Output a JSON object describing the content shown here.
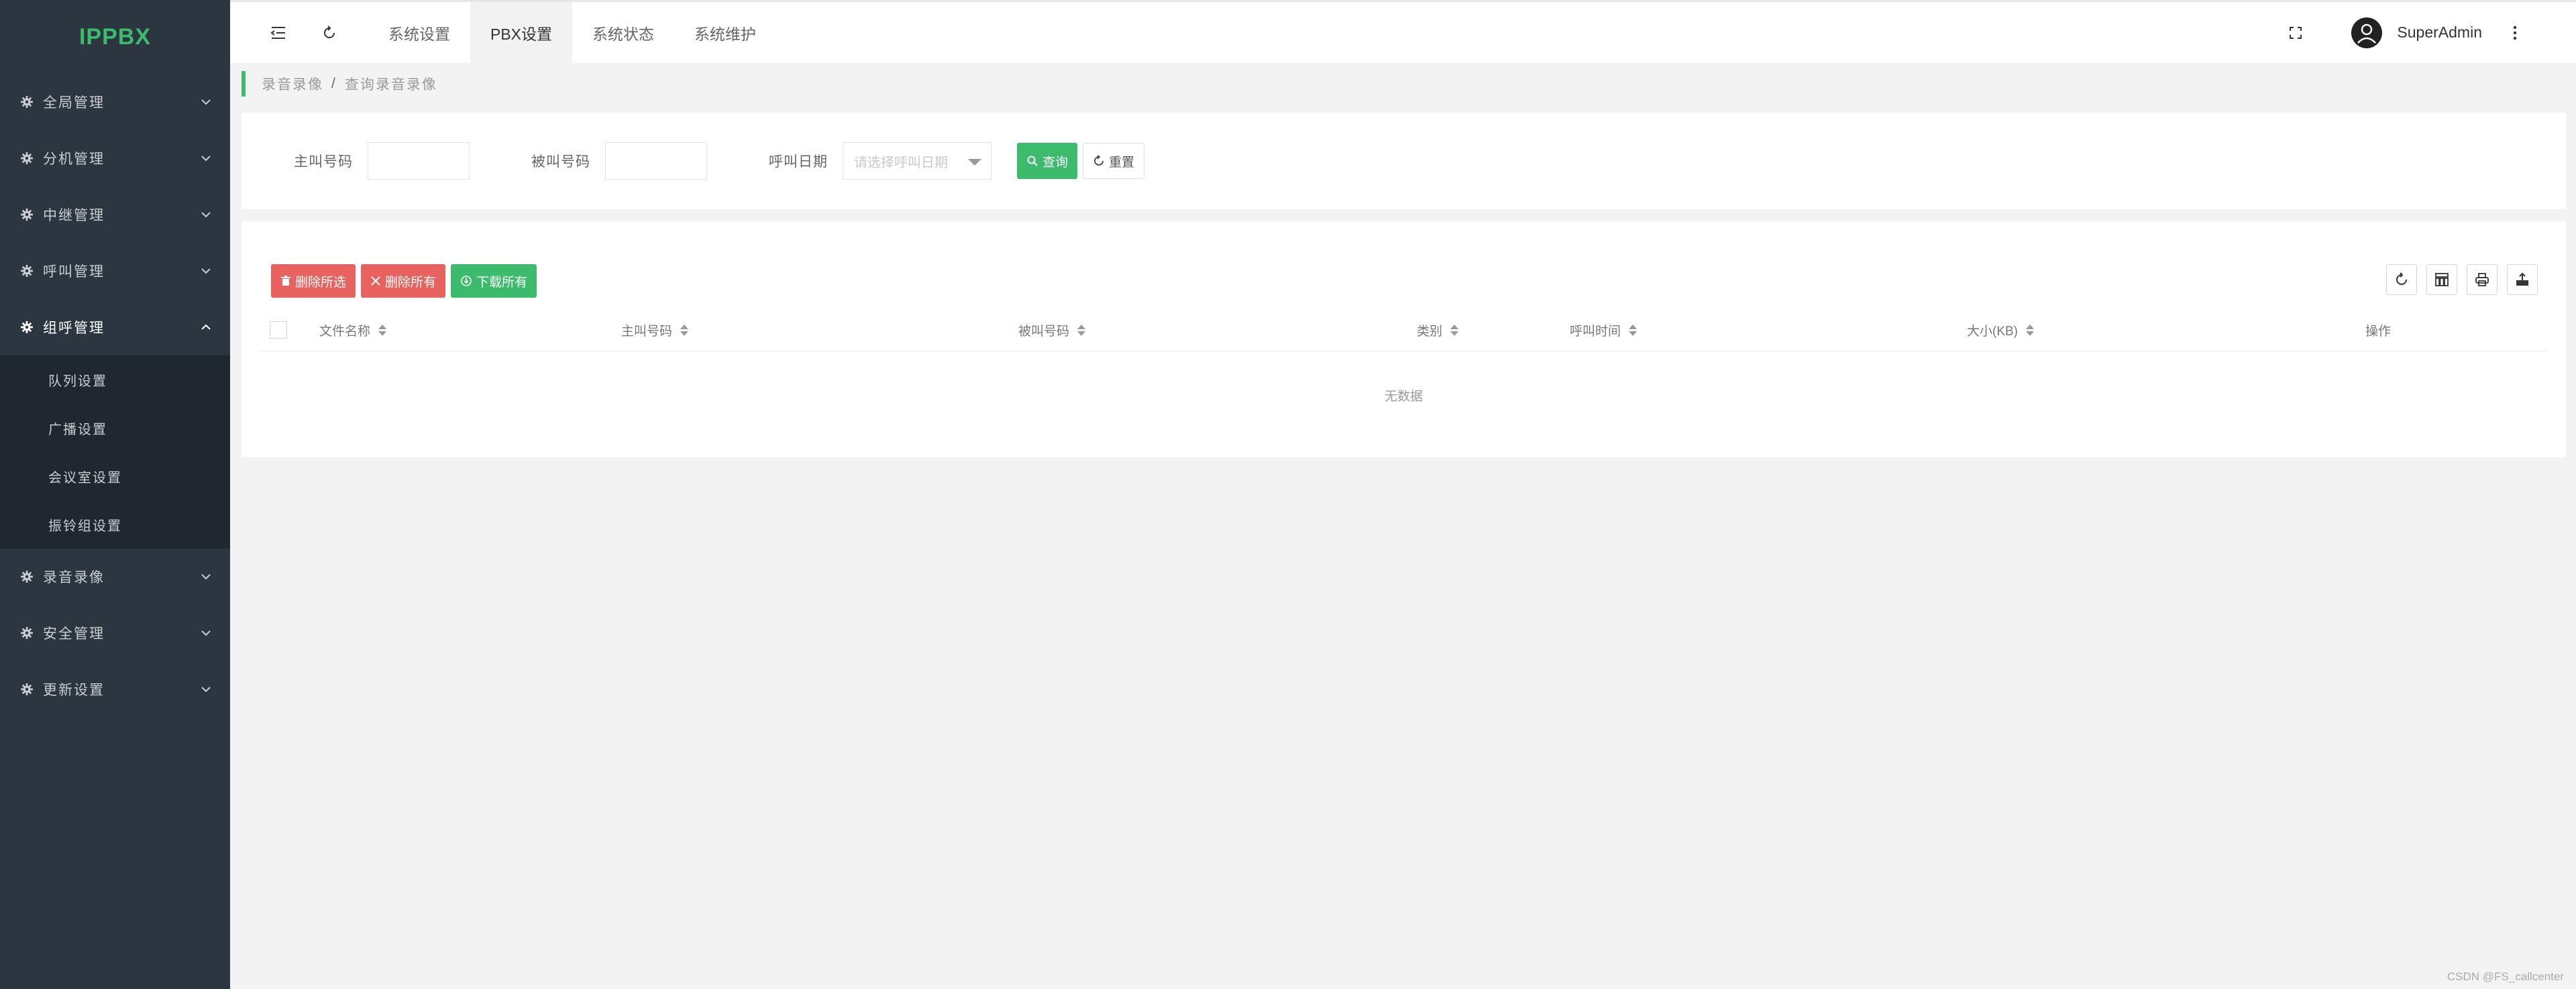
{
  "app": {
    "logo": "IPPBX"
  },
  "sidebar": {
    "items": [
      {
        "label": "全局管理"
      },
      {
        "label": "分机管理"
      },
      {
        "label": "中继管理"
      },
      {
        "label": "呼叫管理"
      },
      {
        "label": "组呼管理",
        "expanded": true,
        "children": [
          "队列设置",
          "广播设置",
          "会议室设置",
          "振铃组设置"
        ]
      },
      {
        "label": "录音录像"
      },
      {
        "label": "安全管理"
      },
      {
        "label": "更新设置"
      }
    ]
  },
  "topbar": {
    "tabs": [
      "系统设置",
      "PBX设置",
      "系统状态",
      "系统维护"
    ],
    "active_tab": "PBX设置",
    "user": "SuperAdmin"
  },
  "breadcrumb": {
    "parent": "录音录像",
    "separator": "/",
    "current": "查询录音录像"
  },
  "search": {
    "caller_label": "主叫号码",
    "callee_label": "被叫号码",
    "date_label": "呼叫日期",
    "date_placeholder": "请选择呼叫日期",
    "query_button": "查询",
    "reset_button": "重置"
  },
  "toolbar": {
    "delete_selected": "删除所选",
    "delete_all": "删除所有",
    "download_all": "下载所有"
  },
  "table": {
    "columns": [
      "文件名称",
      "主叫号码",
      "被叫号码",
      "类别",
      "呼叫时间",
      "大小(KB)",
      "操作"
    ],
    "rows": [],
    "empty_text": "无数据"
  },
  "colors": {
    "sidebar_bg": "#2c3640",
    "accent": "#3dbb6d",
    "danger": "#e8625f"
  },
  "watermark": "CSDN @FS_callcenter"
}
